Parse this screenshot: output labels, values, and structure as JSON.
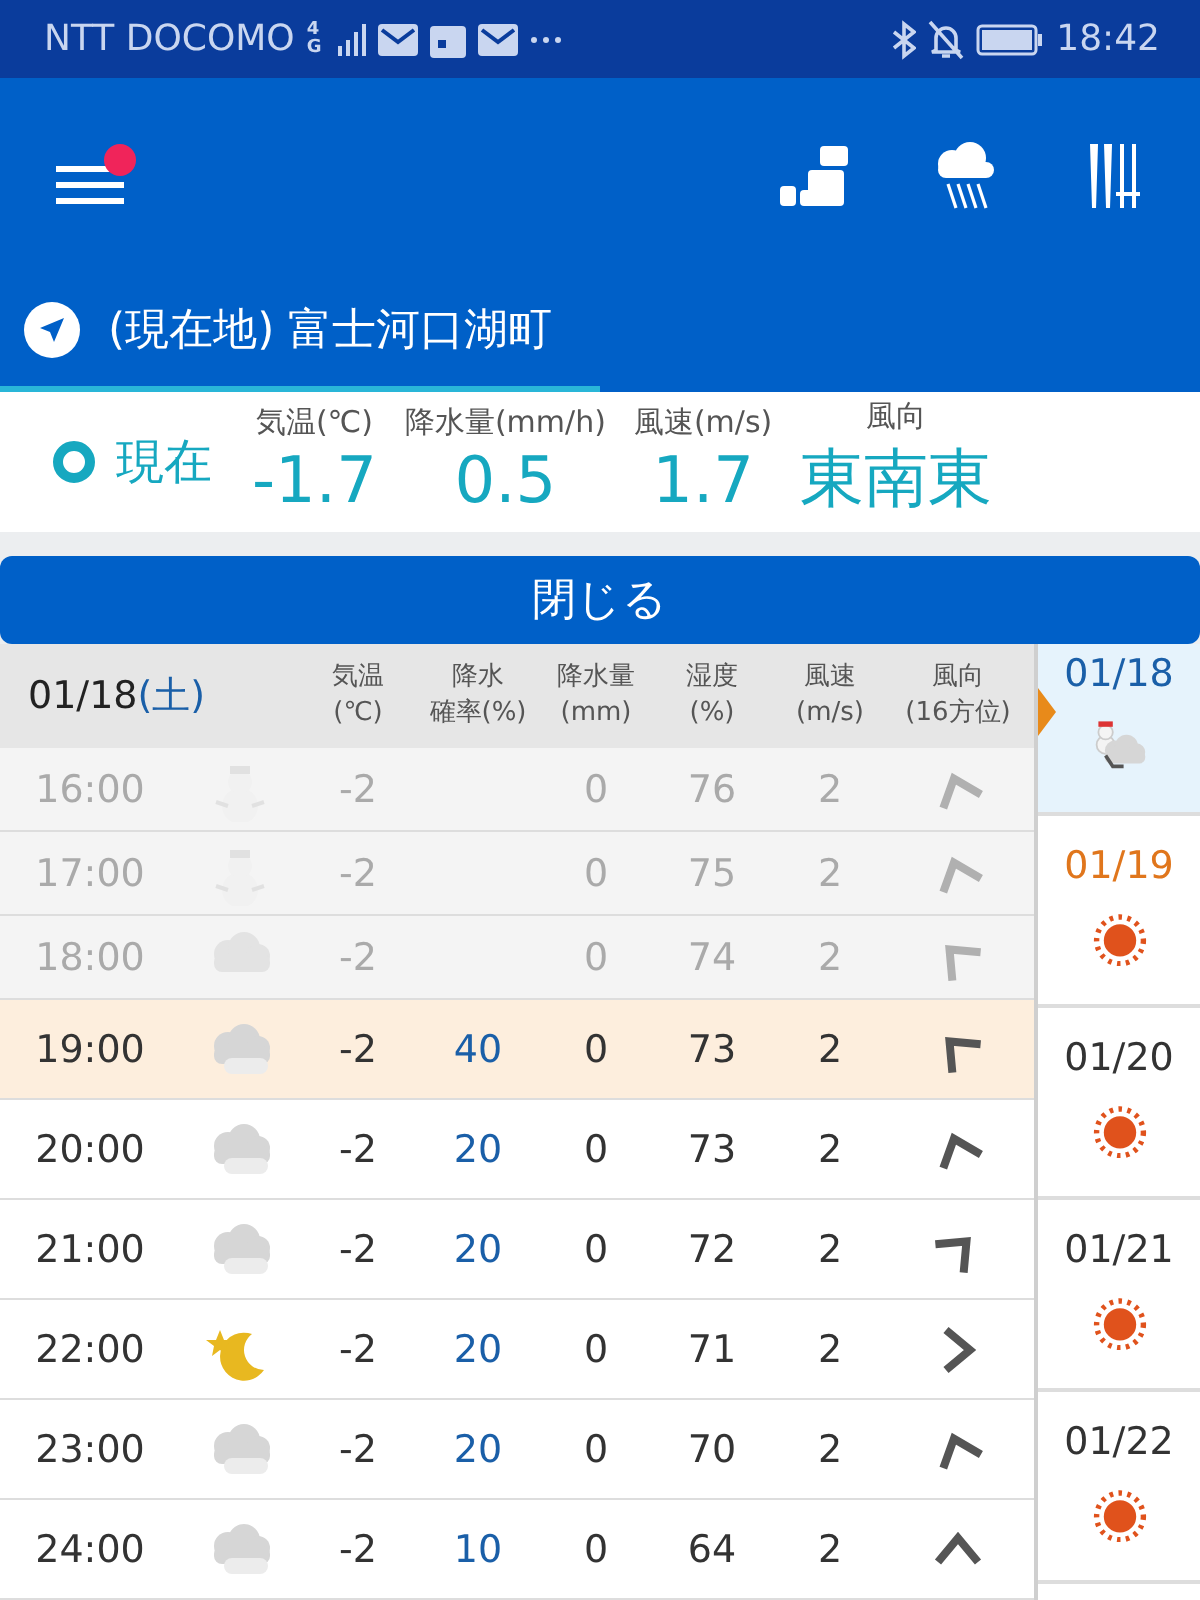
{
  "status_bar": {
    "carrier": "NTT DOCOMO",
    "network": "4G",
    "time": "18:42"
  },
  "location": {
    "title": "(現在地) 富士河口湖町"
  },
  "current": {
    "label": "現在",
    "metrics": [
      {
        "label": "気温(℃)",
        "value": "-1.7"
      },
      {
        "label": "降水量(mm/h)",
        "value": "0.5"
      },
      {
        "label": "風速(m/s)",
        "value": "1.7"
      },
      {
        "label": "風向",
        "value": "東南東"
      }
    ]
  },
  "close_button": "閉じる",
  "table": {
    "date": "01/18",
    "weekday": "(土)",
    "columns": [
      [
        "気温",
        "(℃)"
      ],
      [
        "降水",
        "確率(%)"
      ],
      [
        "降水量",
        "(mm)"
      ],
      [
        "湿度",
        "(%)"
      ],
      [
        "風速",
        "(m/s)"
      ],
      [
        "風向",
        "(16方位)"
      ]
    ],
    "rows": [
      {
        "time": "16:00",
        "weather": {
          "kind": "snowman"
        },
        "temp": "-2",
        "precip": "0",
        "humidity": "76",
        "wind_speed": "2",
        "wind": {
          "kind": "nnw"
        },
        "past": true,
        "current": false
      },
      {
        "time": "17:00",
        "weather": {
          "kind": "snowman"
        },
        "temp": "-2",
        "precip": "0",
        "humidity": "75",
        "wind_speed": "2",
        "wind": {
          "kind": "nnw"
        },
        "past": true,
        "current": false
      },
      {
        "time": "18:00",
        "weather": {
          "kind": "cloud"
        },
        "temp": "-2",
        "precip": "0",
        "humidity": "74",
        "wind_speed": "2",
        "wind": {
          "kind": "nw"
        },
        "past": true,
        "current": false
      },
      {
        "time": "19:00",
        "weather": {
          "kind": "cloudy"
        },
        "temp": "-2",
        "chance": "40",
        "precip": "0",
        "humidity": "73",
        "wind_speed": "2",
        "wind": {
          "kind": "nw"
        },
        "past": false,
        "current": true
      },
      {
        "time": "20:00",
        "weather": {
          "kind": "cloudy"
        },
        "temp": "-2",
        "chance": "20",
        "precip": "0",
        "humidity": "73",
        "wind_speed": "2",
        "wind": {
          "kind": "nnw"
        },
        "past": false,
        "current": false
      },
      {
        "time": "21:00",
        "weather": {
          "kind": "cloudy"
        },
        "temp": "-2",
        "chance": "20",
        "precip": "0",
        "humidity": "72",
        "wind_speed": "2",
        "wind": {
          "kind": "ne"
        },
        "past": false,
        "current": false
      },
      {
        "time": "22:00",
        "weather": {
          "kind": "moon"
        },
        "temp": "-2",
        "chance": "20",
        "precip": "0",
        "humidity": "71",
        "wind_speed": "2",
        "wind": {
          "kind": "e"
        },
        "past": false,
        "current": false
      },
      {
        "time": "23:00",
        "weather": {
          "kind": "cloudy"
        },
        "temp": "-2",
        "chance": "20",
        "precip": "0",
        "humidity": "70",
        "wind_speed": "2",
        "wind": {
          "kind": "nnw"
        },
        "past": false,
        "current": false
      },
      {
        "time": "24:00",
        "weather": {
          "kind": "cloudy"
        },
        "temp": "-2",
        "chance": "10",
        "precip": "0",
        "humidity": "64",
        "wind_speed": "2",
        "wind": {
          "kind": "n"
        },
        "past": false,
        "current": false
      }
    ]
  },
  "days": [
    {
      "date": "01/18",
      "weather": {
        "kind": "snowman_cloud"
      },
      "selected": true,
      "color": "#1a5fa8"
    },
    {
      "date": "01/19",
      "weather": {
        "kind": "sun"
      },
      "selected": false,
      "color": "#e0761c"
    },
    {
      "date": "01/20",
      "weather": {
        "kind": "sun"
      },
      "selected": false,
      "color": "#333333"
    },
    {
      "date": "01/21",
      "weather": {
        "kind": "sun"
      },
      "selected": false,
      "color": "#333333"
    },
    {
      "date": "01/22",
      "weather": {
        "kind": "sun"
      },
      "selected": false,
      "color": "#333333"
    }
  ]
}
